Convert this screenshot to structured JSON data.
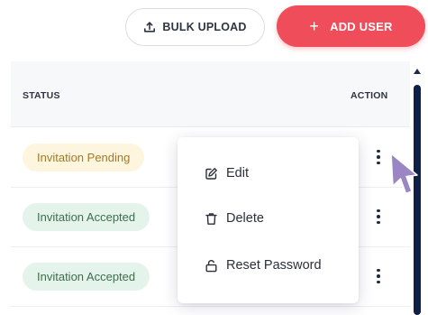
{
  "toolbar": {
    "bulk_upload_label": "BULK UPLOAD",
    "add_user_label": "ADD USER",
    "add_user_plus": "+"
  },
  "table": {
    "headers": {
      "status": "STATUS",
      "action": "ACTION"
    },
    "rows": [
      {
        "status": "Invitation Pending"
      },
      {
        "status": "Invitation Accepted"
      },
      {
        "status": "Invitation Accepted"
      }
    ]
  },
  "menu": {
    "items": [
      {
        "label": "Edit",
        "icon": "edit-icon"
      },
      {
        "label": "Delete",
        "icon": "trash-icon"
      },
      {
        "label": "Reset Password",
        "icon": "lock-icon"
      }
    ]
  },
  "colors": {
    "accent": "#ef4d5a",
    "pending_bg": "#fdf5dd",
    "pending_text": "#a07a2b",
    "accepted_bg": "#e5f4ea",
    "accepted_text": "#3f6b4f",
    "cursor": "#9b86c4"
  }
}
